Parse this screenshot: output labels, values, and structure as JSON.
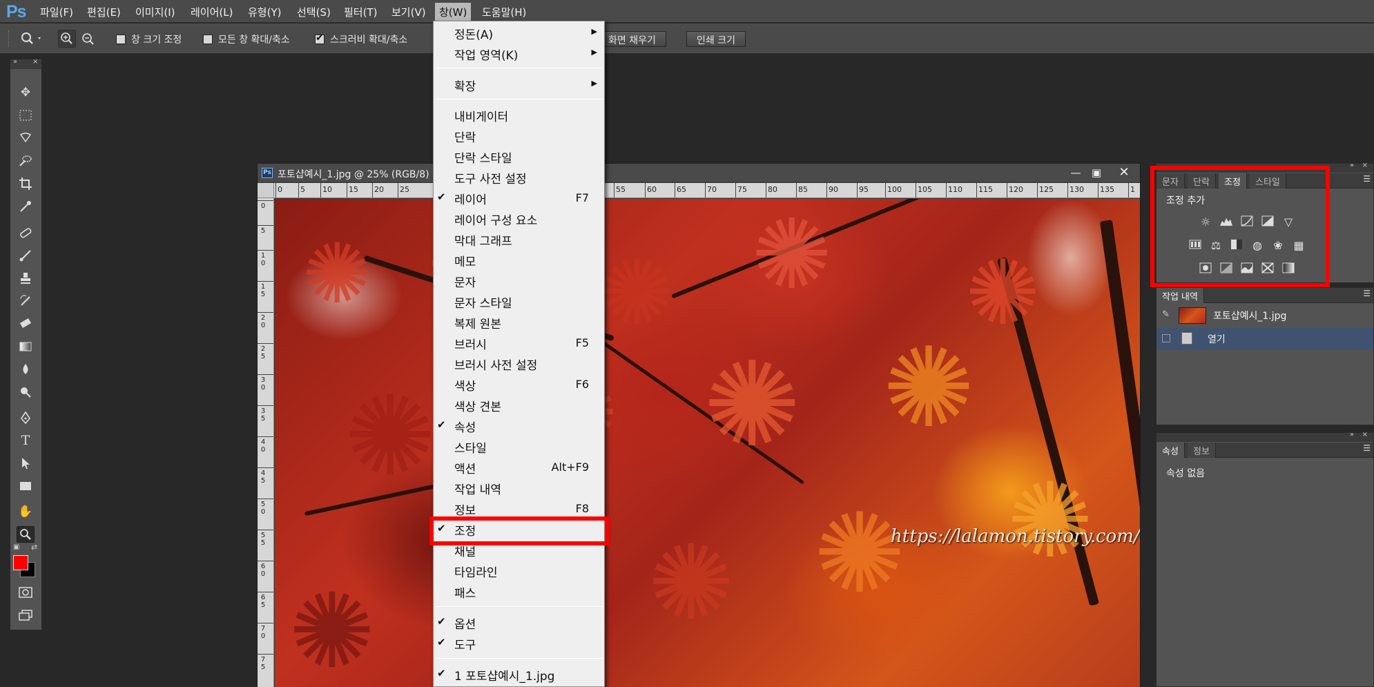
{
  "app": {
    "logo": "Ps"
  },
  "menubar": {
    "items": [
      "파일(F)",
      "편집(E)",
      "이미지(I)",
      "레이어(L)",
      "유형(Y)",
      "선택(S)",
      "필터(T)",
      "보기(V)",
      "창(W)",
      "도움말(H)"
    ],
    "active": "창(W)"
  },
  "options": {
    "resize_windows": "창 크기 조정",
    "zoom_all": "모든 창 확대/축소",
    "scrubby_zoom": "스크러비 확대/축소",
    "fill_screen": "화면 채우기",
    "print_size": "인쇄 크기",
    "resize_checked": false,
    "zoom_all_checked": false,
    "scrubby_checked": true
  },
  "document": {
    "title": "포토샵예시_1.jpg @ 25% (RGB/8)",
    "hruler": [
      "0",
      "5",
      "10",
      "15",
      "20",
      "25",
      "55",
      "60",
      "65",
      "70",
      "75",
      "80",
      "85",
      "90",
      "95",
      "100",
      "105",
      "110",
      "115",
      "120",
      "125",
      "130",
      "135",
      "1"
    ],
    "vruler": [
      "0",
      "5",
      "10",
      "15",
      "20",
      "25",
      "30",
      "35",
      "40",
      "45",
      "50",
      "55",
      "60",
      "65",
      "70",
      "75"
    ],
    "watermark": "https://lalamon.tistory.com/"
  },
  "window_menu": {
    "items": [
      {
        "label": "정돈(A)",
        "submenu": true
      },
      {
        "label": "작업 영역(K)",
        "submenu": true
      },
      {
        "label": "확장",
        "submenu": true
      },
      {
        "label": "내비게이터"
      },
      {
        "label": "단락"
      },
      {
        "label": "단락 스타일"
      },
      {
        "label": "도구 사전 설정"
      },
      {
        "label": "레이어",
        "checked": true,
        "shortcut": "F7"
      },
      {
        "label": "레이어 구성 요소"
      },
      {
        "label": "막대 그래프"
      },
      {
        "label": "메모"
      },
      {
        "label": "문자"
      },
      {
        "label": "문자 스타일"
      },
      {
        "label": "복제 원본"
      },
      {
        "label": "브러시",
        "shortcut": "F5"
      },
      {
        "label": "브러시 사전 설정"
      },
      {
        "label": "색상",
        "shortcut": "F6"
      },
      {
        "label": "색상 견본"
      },
      {
        "label": "속성",
        "checked": true
      },
      {
        "label": "스타일"
      },
      {
        "label": "액션",
        "shortcut": "Alt+F9"
      },
      {
        "label": "작업 내역"
      },
      {
        "label": "정보",
        "shortcut": "F8"
      },
      {
        "label": "조정",
        "checked": true
      },
      {
        "label": "채널"
      },
      {
        "label": "타임라인"
      },
      {
        "label": "패스"
      },
      {
        "label": "옵션",
        "checked": true
      },
      {
        "label": "도구",
        "checked": true
      },
      {
        "label": "1 포토샵예시_1.jpg",
        "checked": true
      }
    ]
  },
  "adjust_panel": {
    "tabs": [
      "문자",
      "단락",
      "조정",
      "스타일"
    ],
    "active_tab": "조정",
    "heading": "조정 추가"
  },
  "history_panel": {
    "tab": "작업 내역",
    "snapshot": "포토샵예시_1.jpg",
    "step": "열기"
  },
  "props_panel": {
    "tabs": [
      "속성",
      "정보"
    ],
    "active_tab": "속성",
    "empty": "속성 없음"
  },
  "colors": {
    "foreground": "#ff0000",
    "background": "#000000",
    "highlight": "#ff0000"
  }
}
